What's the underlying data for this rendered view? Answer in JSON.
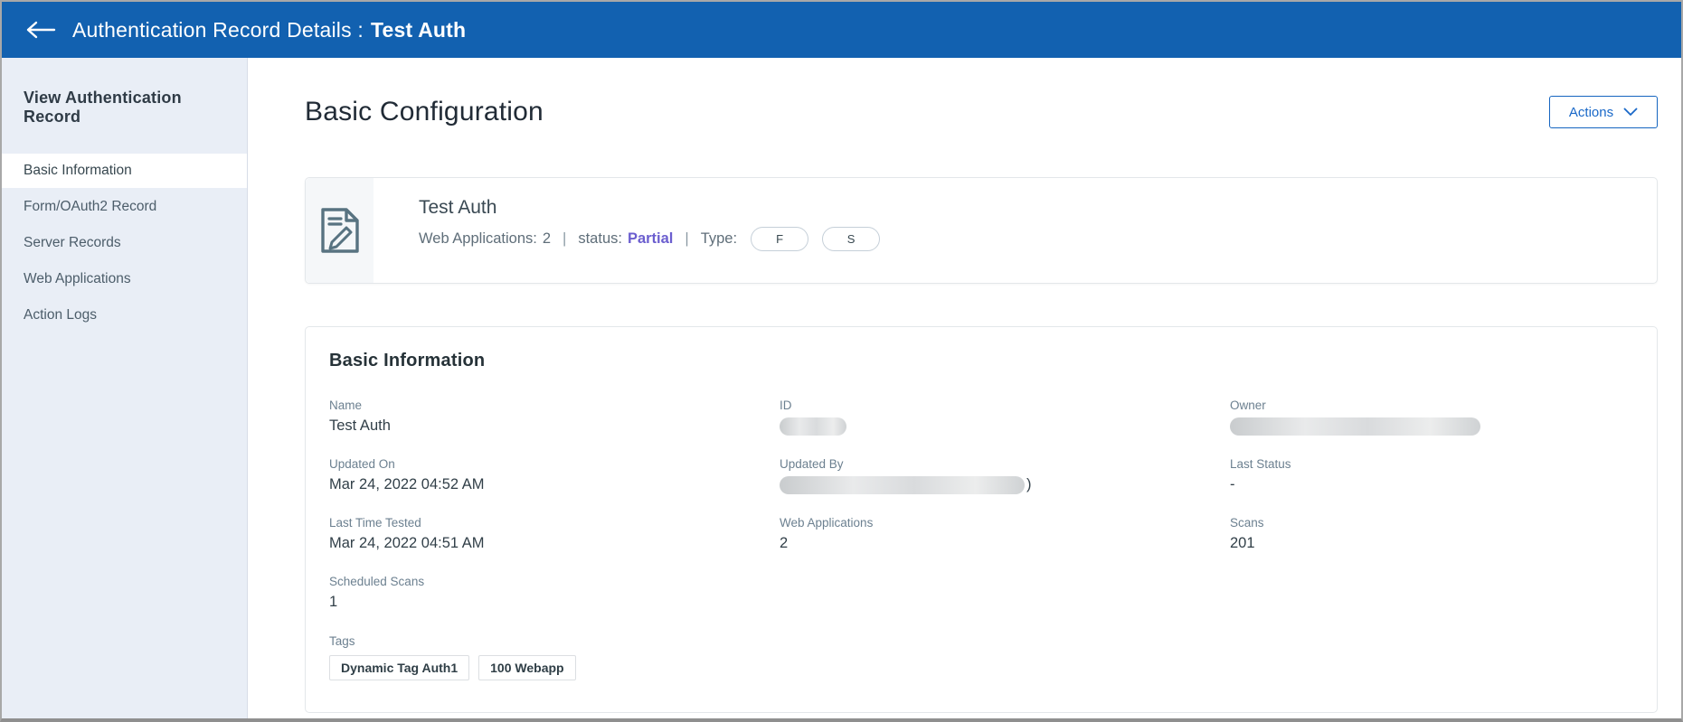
{
  "header": {
    "title": "Authentication Record Details :",
    "record_name": "Test Auth"
  },
  "sidebar": {
    "heading": "View Authentication Record",
    "items": [
      {
        "label": "Basic Information",
        "active": true
      },
      {
        "label": "Form/OAuth2 Record",
        "active": false
      },
      {
        "label": "Server Records",
        "active": false
      },
      {
        "label": "Web Applications",
        "active": false
      },
      {
        "label": "Action Logs",
        "active": false
      }
    ]
  },
  "main": {
    "page_title": "Basic Configuration",
    "actions_button": {
      "label": "Actions",
      "icon": "chevron-down-icon"
    },
    "summary": {
      "icon": "document-edit-icon",
      "record_name": "Test Auth",
      "web_applications_label": "Web Applications:",
      "web_applications_value": "2",
      "status_label": "status:",
      "status_value": "Partial",
      "type_label": "Type:",
      "type_badges": {
        "0": "F",
        "1": "S"
      },
      "separator": "|"
    },
    "basic_information": {
      "heading": "Basic Information",
      "fields": {
        "0": {
          "label": "Name",
          "value": "Test Auth"
        },
        "1": {
          "label": "ID",
          "value": "",
          "redacted": true
        },
        "2": {
          "label": "Owner",
          "value": "",
          "redacted": true
        },
        "3": {
          "label": "Updated On",
          "value": "Mar 24, 2022 04:52 AM"
        },
        "4": {
          "label": "Updated By",
          "value": "",
          "redacted": true,
          "suffix": ")"
        },
        "5": {
          "label": "Last Status",
          "value": "-"
        },
        "6": {
          "label": "Last Time Tested",
          "value": "Mar 24, 2022 04:51 AM"
        },
        "7": {
          "label": "Web Applications",
          "value": "2"
        },
        "8": {
          "label": "Scans",
          "value": "201"
        },
        "9": {
          "label": "Scheduled Scans",
          "value": "1"
        }
      },
      "tags": {
        "label": "Tags",
        "chips": {
          "0": "Dynamic Tag Auth1",
          "1": "100 Webapp"
        }
      }
    }
  },
  "colors": {
    "topbar_blue": "#1261b0",
    "sidebar_bg": "#e9eef6",
    "status_partial": "#6b5ecf",
    "actions_blue": "#1565c0"
  }
}
